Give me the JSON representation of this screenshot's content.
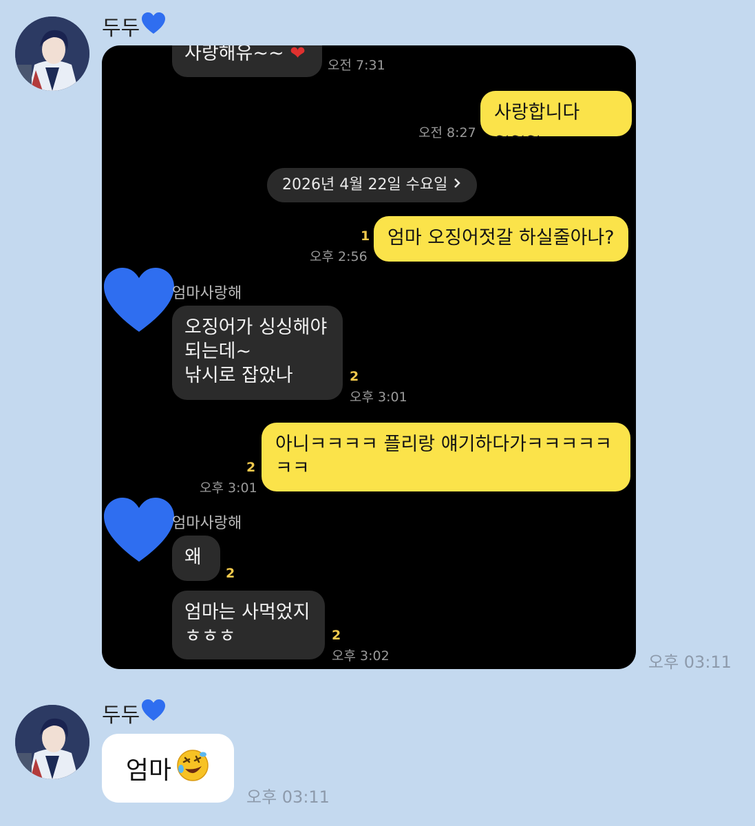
{
  "messages": [
    {
      "sender": "두두",
      "sender_heart": "💙",
      "time": "오후 03:11",
      "embedded_chat": {
        "partial_bubble_text": "사랑해유~~",
        "partial_time": "오전 7:31",
        "sent_1": {
          "text": "사랑합니다~~~",
          "time": "오전 8:27"
        },
        "date_divider": "2026년 4월 22일 수요일",
        "sent_2": {
          "text": "엄마 오징어젓갈 하실줄아나?",
          "time": "오후 2:56",
          "unread": "1"
        },
        "recv_1": {
          "name": "엄마사랑해",
          "lines": [
            "오징어가 싱싱해야",
            "되는데~",
            "낚시로 잡았나"
          ],
          "time": "오후 3:01",
          "unread": "2"
        },
        "sent_3": {
          "lines": [
            "아니ㅋㅋㅋㅋ 플리랑 얘기하다가ㅋㅋㅋㅋㅋ",
            "ㅋㅋ"
          ],
          "time": "오후 3:01",
          "unread": "2"
        },
        "recv_2": {
          "name": "엄마사랑해",
          "text": "왜",
          "unread": "2",
          "lines_2": [
            "엄마는 사먹었지",
            "ㅎㅎㅎ"
          ],
          "time_2": "오후 3:02",
          "unread_2": "2"
        }
      }
    },
    {
      "sender": "두두",
      "sender_heart": "💙",
      "text": "엄마",
      "emoji": "🤣",
      "time": "오후 03:11"
    }
  ],
  "colors": {
    "background": "#c4d9ef",
    "yellow_bubble": "#fbe34a",
    "dark_bubble": "#2b2b2b",
    "heart_blue": "#2f6ef0",
    "unread_yellow": "#f2c94c"
  },
  "icons": {
    "heart": "blue-heart-icon",
    "chevron": "chevron-right-icon",
    "emoji": "rolling-laughing-emoji-icon"
  }
}
